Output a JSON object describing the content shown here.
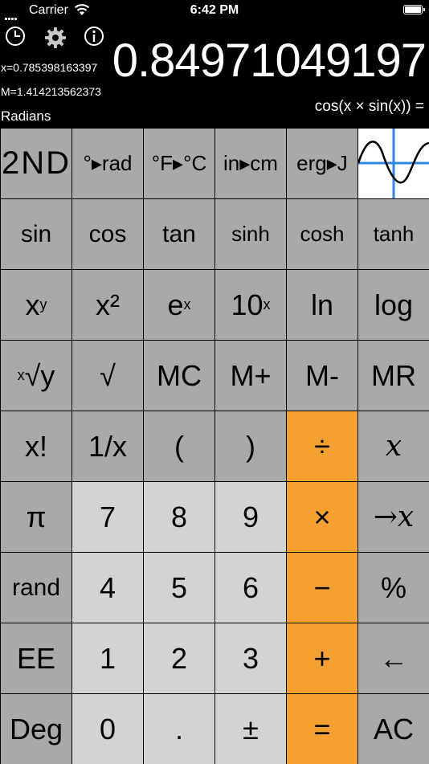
{
  "status_bar": {
    "carrier": "Carrier",
    "time": "6:42 PM"
  },
  "top_icons": [
    "history-icon",
    "gear-icon",
    "info-icon"
  ],
  "display": {
    "value": "0.84971049197",
    "x_line": "x=0.785398163397",
    "m_line": "M=1.414213562373",
    "expression": "cos(x × sin(x)) =",
    "angle_mode": "Radians"
  },
  "keys": {
    "row1": [
      "2ND",
      "°▸rad",
      "°F▸°C",
      "in▸cm",
      "erg▸J",
      ""
    ],
    "row2": [
      "sin",
      "cos",
      "tan",
      "sinh",
      "cosh",
      "tanh"
    ],
    "row3": [
      "xy",
      "x²",
      "ex",
      "10x",
      "ln",
      "log"
    ],
    "row4": [
      "x√y",
      "√",
      "MC",
      "M+",
      "M-",
      "MR"
    ],
    "row5": [
      "x!",
      "1/x",
      "(",
      ")",
      "÷",
      "x"
    ],
    "row6": [
      "π",
      "7",
      "8",
      "9",
      "×",
      "→x"
    ],
    "row7": [
      "rand",
      "4",
      "5",
      "6",
      "−",
      "%"
    ],
    "row8": [
      "EE",
      "1",
      "2",
      "3",
      "+",
      "←"
    ],
    "row9": [
      "Deg",
      "0",
      ".",
      "±",
      "=",
      "AC"
    ]
  },
  "colors": {
    "dark_key": "#a9a9a9",
    "light_key": "#d3d3d3",
    "operator_key": "#f7a032",
    "graph_axis": "#2f87e0"
  }
}
